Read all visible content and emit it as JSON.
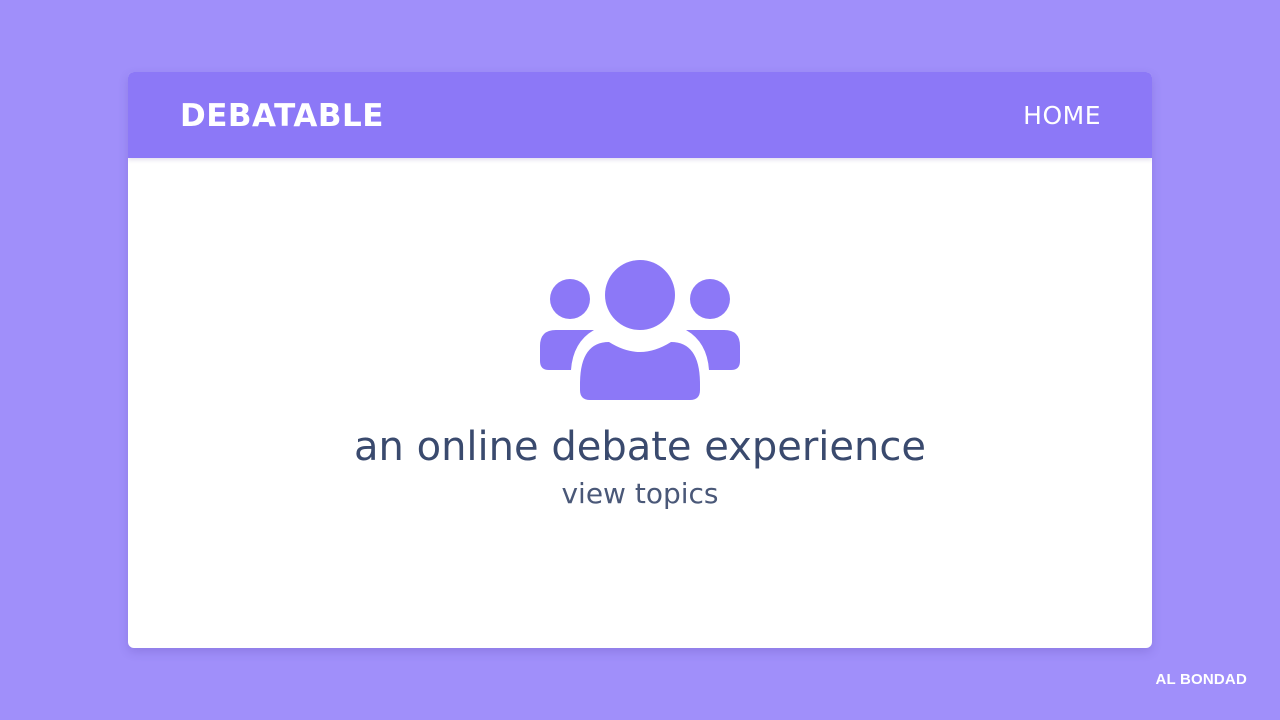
{
  "colors": {
    "background": "#a08ffa",
    "accent": "#8c78f7",
    "card": "#ffffff",
    "text_primary": "#3a4a6e"
  },
  "navbar": {
    "brand": "DEBATABLE",
    "home_label": "HOME"
  },
  "hero": {
    "icon": "users-group-icon",
    "tagline": "an online debate experience",
    "link_label": "view topics"
  },
  "credit": "AL BONDAD"
}
